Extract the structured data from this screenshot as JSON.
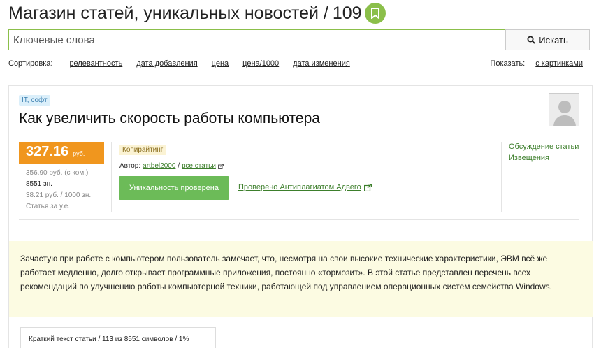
{
  "header": {
    "title": "Магазин статей, уникальных новостей /",
    "count": "109",
    "bookmark_icon": "bookmark-icon"
  },
  "search": {
    "placeholder": "Ключевые слова",
    "button_label": "Искать",
    "button_icon": "search-icon"
  },
  "sort": {
    "label": "Сортировка:",
    "options": [
      "релевантность",
      "дата добавления",
      "цена",
      "цена/1000",
      "дата изменения"
    ],
    "show_label": "Показать:",
    "show_option": "с картинками"
  },
  "article": {
    "category": "IT, софт",
    "title": "Как увеличить скорость работы компьютера",
    "price": "327.16",
    "price_unit": "руб.",
    "price_with_commission": "356.90 руб. (с ком.)",
    "chars": "8551 зн.",
    "price_per_1000": "38.21 руб. / 1000 зн.",
    "price_type": "Статья за у.е.",
    "type_badge": "Копирайтинг",
    "author_label": "Автор:",
    "author_name": "artbel2000",
    "author_sep": "/",
    "all_articles": "все статьи",
    "unique_button": "Уникальность проверена",
    "checked_link": "Проверено Антиплагиатом Адвего",
    "discussion_link": "Обсуждение статьи",
    "notices_link": "Извещения",
    "description": "Зачастую при работе с компьютером пользователь замечает, что, несмотря на свои высокие технические характеристики, ЭВМ всё же работает медленно, долго открывает программные приложения, постоянно «тормозит». В этой статье представлен перечень всех рекомендаций по улучшению работы компьютерной техники, работающей под управлением операционных систем семейства Windows.",
    "tab_label": "Краткий текст статьи / 113 из 8551 символов / 1%"
  },
  "colors": {
    "accent_green": "#8bbf4a",
    "price_orange": "#f0961e",
    "button_green": "#6cbb58",
    "link_green": "#3d7f2c",
    "desc_bg": "#fcfbe2"
  }
}
